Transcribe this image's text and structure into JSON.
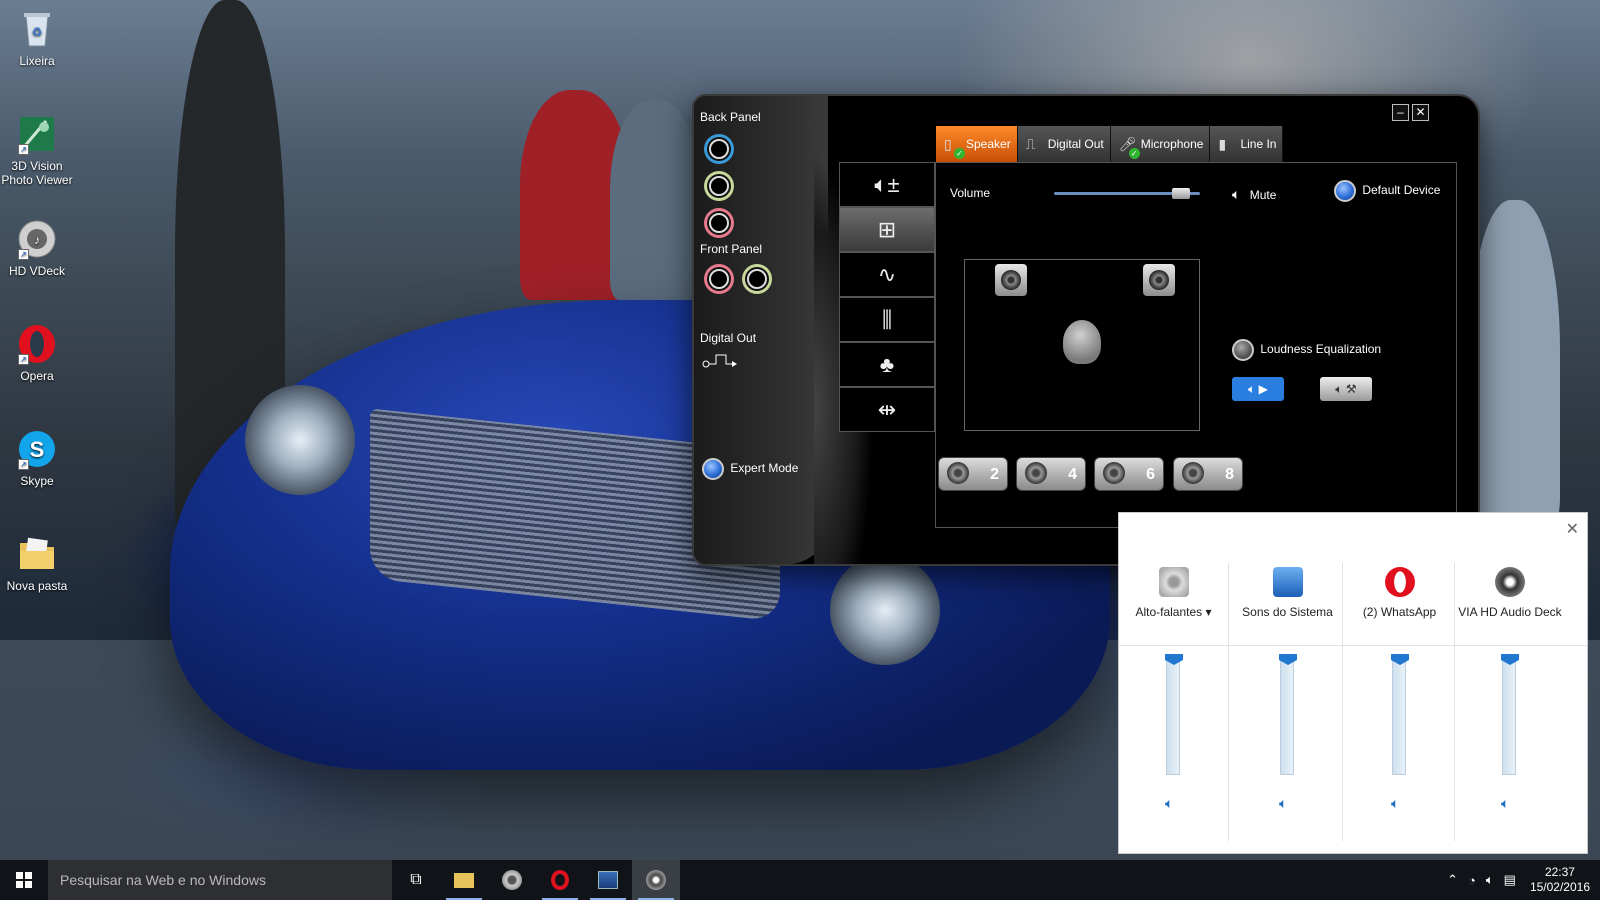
{
  "desktop": {
    "icons": [
      {
        "label": "Lixeira",
        "icon": "recycle-bin-icon"
      },
      {
        "label": "3D Vision Photo Viewer",
        "icon": "3d-vision-icon"
      },
      {
        "label": "HD VDeck",
        "icon": "hd-vdeck-icon"
      },
      {
        "label": "Opera",
        "icon": "opera-icon"
      },
      {
        "label": "Skype",
        "icon": "skype-icon"
      },
      {
        "label": "Nova pasta",
        "icon": "folder-icon"
      }
    ]
  },
  "deck": {
    "back_panel_label": "Back Panel",
    "front_panel_label": "Front Panel",
    "digital_out_label": "Digital Out",
    "expert_mode_label": "Expert Mode",
    "tabs": [
      {
        "label": "Speaker",
        "active": true,
        "checked": true
      },
      {
        "label": "Digital Out",
        "active": false,
        "checked": false
      },
      {
        "label": "Microphone",
        "active": false,
        "checked": true
      },
      {
        "label": "Line In",
        "active": false,
        "checked": false
      }
    ],
    "volume_label": "Volume",
    "volume_level": 0.92,
    "mute_label": "Mute",
    "default_device_label": "Default Device",
    "loudness_label": "Loudness Equalization",
    "channels": [
      "2",
      "4",
      "6",
      "8"
    ],
    "jack_colors": {
      "back": [
        "#3a9ad9",
        "#c8d89a",
        "#e87a90"
      ],
      "front": [
        "#e87a90",
        "#c8d89a"
      ]
    },
    "accent": "#e8670f"
  },
  "mixer": {
    "columns": [
      {
        "name": "Alto-falantes",
        "has_dropdown": true,
        "level": 1.0
      },
      {
        "name": "Sons do Sistema",
        "has_dropdown": false,
        "level": 1.0
      },
      {
        "name": "(2) WhatsApp",
        "has_dropdown": false,
        "level": 1.0
      },
      {
        "name": "VIA HD Audio Deck",
        "has_dropdown": false,
        "level": 1.0
      }
    ]
  },
  "taskbar": {
    "search_placeholder": "Pesquisar na Web e no Windows",
    "time": "22:37",
    "date": "15/02/2016"
  }
}
